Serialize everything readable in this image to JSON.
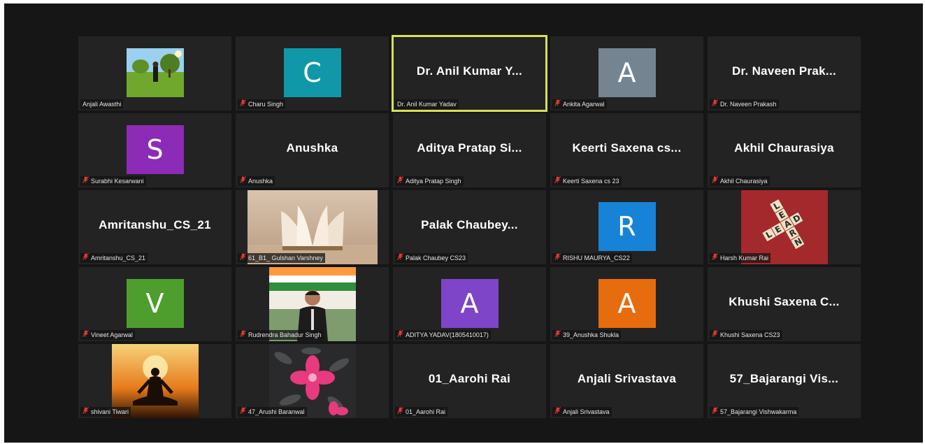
{
  "meeting": {
    "active_speaker_color": "#d4e157",
    "mic_muted_color": "#e53935",
    "participants": [
      {
        "name": "Anjali Awasthi",
        "type": "video",
        "scene": "meadow",
        "muted": false
      },
      {
        "name": "Charu Singh",
        "type": "initial",
        "initial": "C",
        "color": "#1098a8",
        "muted": true
      },
      {
        "name": "Dr. Anil Kumar Yadav",
        "type": "name",
        "display": "Dr. Anil Kumar Y...",
        "muted": false,
        "active": true
      },
      {
        "name": "Ankita Agarwal",
        "type": "initial",
        "initial": "A",
        "color": "#748591",
        "muted": true
      },
      {
        "name": "Dr. Naveen Prakash",
        "type": "name",
        "display": "Dr. Naveen Prak...",
        "muted": true
      },
      {
        "name": "Surabhi Kesarwani",
        "type": "initial",
        "initial": "S",
        "color": "#8c2bb5",
        "muted": true
      },
      {
        "name": "Anushka",
        "type": "name",
        "display": "Anushka",
        "muted": true
      },
      {
        "name": "Aditya Pratap Singh",
        "type": "name",
        "display": "Aditya Pratap Si...",
        "muted": true
      },
      {
        "name": "Keerti Saxena cs 23",
        "type": "name",
        "display": "Keerti Saxena cs...",
        "muted": true
      },
      {
        "name": "Akhil Chaurasiya",
        "type": "name",
        "display": "Akhil Chaurasiya",
        "muted": true
      },
      {
        "name": "Amritanshu_CS_21",
        "type": "name",
        "display": "Amritanshu_CS_21",
        "muted": true
      },
      {
        "name": "61_B1_ Gulshan Varshney",
        "type": "video",
        "scene": "book",
        "muted": true
      },
      {
        "name": "Palak Chaubey  CS23",
        "type": "name",
        "display": "Palak  Chaubey...",
        "muted": true
      },
      {
        "name": "RISHU MAURYA_CS22",
        "type": "initial",
        "initial": "R",
        "color": "#1683d6",
        "muted": true
      },
      {
        "name": "Harsh Kumar Rai",
        "type": "video",
        "scene": "tiles",
        "muted": true
      },
      {
        "name": "Vineet Agarwal",
        "type": "initial",
        "initial": "V",
        "color": "#4e9e2e",
        "muted": true
      },
      {
        "name": "Rudrendra Bahadur Singh",
        "type": "video",
        "scene": "person",
        "muted": true
      },
      {
        "name": "ADITYA YADAV(1805410017)",
        "type": "initial",
        "initial": "A",
        "color": "#7f45c8",
        "muted": true
      },
      {
        "name": "39_Anushka Shukla",
        "type": "initial",
        "initial": "A",
        "color": "#e66c0e",
        "muted": true
      },
      {
        "name": "Khushi Saxena CS23",
        "type": "name",
        "display": "Khushi  Saxena  C...",
        "muted": true
      },
      {
        "name": "shivani Tiwari",
        "type": "video",
        "scene": "meditation",
        "muted": true
      },
      {
        "name": "47_Arushi Baranwal",
        "type": "video",
        "scene": "flower",
        "muted": true
      },
      {
        "name": "01_Aarohi Rai",
        "type": "name",
        "display": "01_Aarohi Rai",
        "muted": true
      },
      {
        "name": "Anjali Srivastava",
        "type": "name",
        "display": "Anjali Srivastava",
        "muted": true
      },
      {
        "name": "57_Bajarangi Vishwakarma",
        "type": "name",
        "display": "57_Bajarangi  Vis...",
        "muted": true
      }
    ]
  },
  "tile_text": [
    "LEARN",
    "LEAD"
  ]
}
